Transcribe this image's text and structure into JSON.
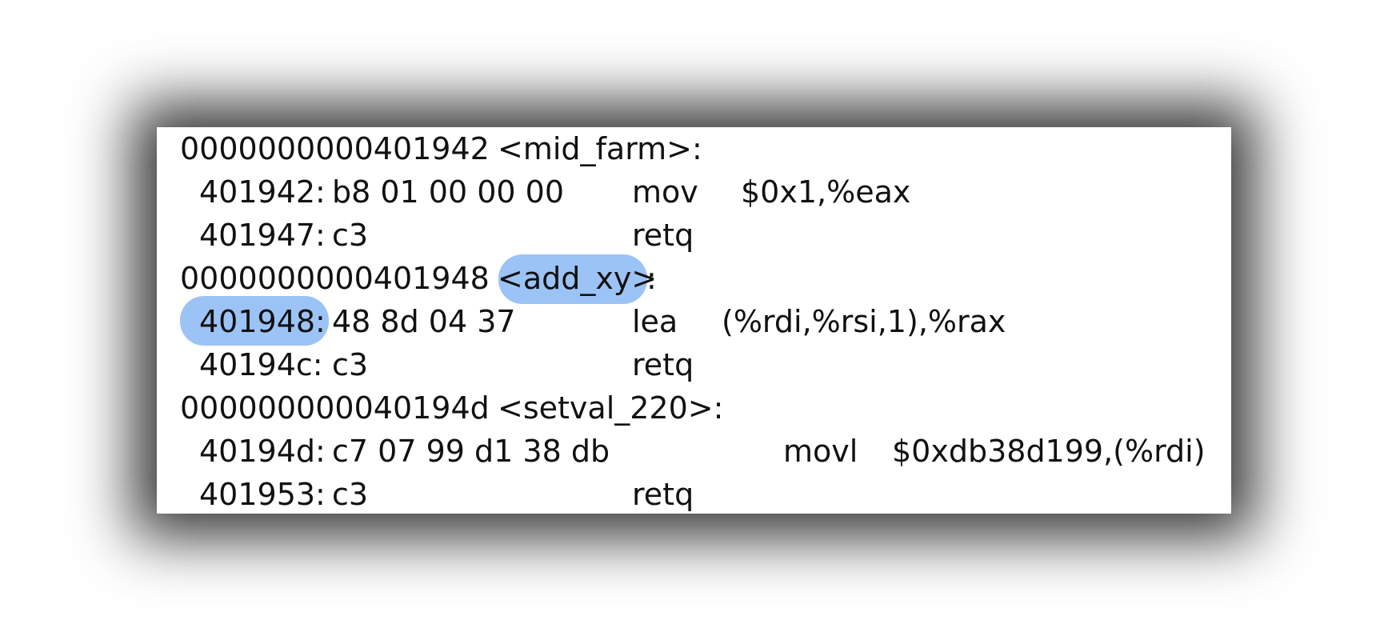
{
  "colors": {
    "highlight": "#9cc3f5",
    "text": "#111111",
    "panel_background": "#ffffff",
    "shadow": "#000000"
  },
  "listing": {
    "rows": [
      {
        "kind": "label",
        "address": "0000000000401942",
        "symbol": "<mid_farm>:"
      },
      {
        "kind": "instr",
        "address": "401942:",
        "bytes": "b8 01 00 00 00",
        "mnemonic": "mov",
        "operands": "$0x1,%eax"
      },
      {
        "kind": "instr",
        "address": "401947:",
        "bytes": "c3",
        "mnemonic": "retq",
        "operands": ""
      },
      {
        "kind": "label",
        "address": "0000000000401948",
        "symbol_open": "<add_xy>",
        "symbol_colon": ":",
        "highlighted": true
      },
      {
        "kind": "instr",
        "address": "401948:",
        "bytes": "48 8d 04 37",
        "mnemonic": "lea",
        "operands": "(%rdi,%rsi,1),%rax",
        "highlighted": true
      },
      {
        "kind": "instr",
        "address": "40194c:",
        "bytes": "c3",
        "mnemonic": "retq",
        "operands": ""
      },
      {
        "kind": "label",
        "address": "000000000040194d",
        "symbol": "<setval_220>:"
      },
      {
        "kind": "instr",
        "address": "40194d:",
        "bytes": "c7 07 99 d1 38 db",
        "mnemonic": "movl",
        "operands": "$0xdb38d199,(%rdi)"
      },
      {
        "kind": "instr",
        "address": "401953:",
        "bytes": "c3",
        "mnemonic": "retq",
        "operands": ""
      }
    ]
  }
}
